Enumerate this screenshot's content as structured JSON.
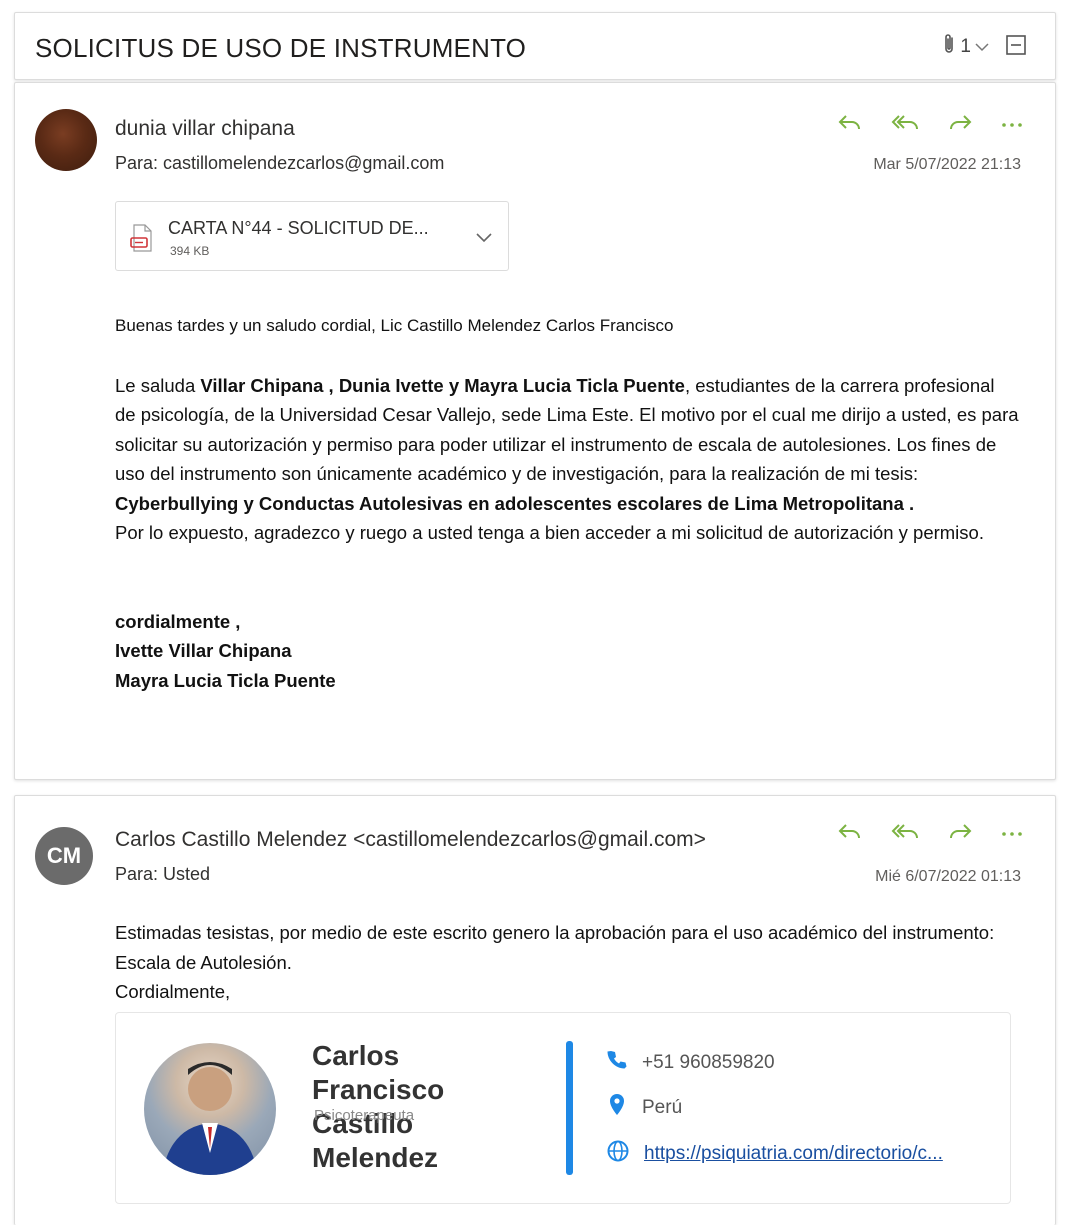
{
  "thread": {
    "subject": "SOLICITUS DE USO DE INSTRUMENTO",
    "attachment_count": "1"
  },
  "message1": {
    "sender": "dunia villar chipana",
    "to": "Para:  castillomelendezcarlos@gmail.com",
    "timestamp": "Mar 5/07/2022 21:13",
    "attachment": {
      "name": "CARTA N°44 - SOLICITUD DE...",
      "size": "394 KB"
    },
    "greeting": "Buenas tardes y un saludo cordial, Lic  Castillo Melendez Carlos Francisco",
    "para1_a": "Le saluda ",
    "para1_b": "Villar Chipana , Dunia Ivette  y Mayra  Lucia Ticla Puente",
    "para1_c": ", estudiantes de la carrera profesional de psicología, de la Universidad Cesar Vallejo, sede Lima Este. El motivo por el cual me dirijo a usted, es para solicitar su autorización y permiso para poder utilizar el instrumento de escala de autolesiones. Los fines de uso del instrumento son únicamente académico y de investigación, para la realización de mi tesis: ",
    "para1_d": "Cyberbullying y Conductas Autolesivas en adolescentes escolares de Lima Metropolitana .",
    "para2": "Por lo expuesto, agradezco y ruego a usted tenga a bien acceder a mi solicitud de autorización y permiso.",
    "sign1": "cordialmente ,",
    "sign2": "Ivette Villar Chipana",
    "sign3": " Mayra  Lucia Ticla Puente"
  },
  "message2": {
    "avatar_initials": "CM",
    "sender": "Carlos Castillo Melendez <castillomelendezcarlos@gmail.com>",
    "to": "Para:  Usted",
    "timestamp": "Mié 6/07/2022 01:13",
    "body1": "Estimadas tesistas, por medio de este escrito genero la aprobación para el uso académico del instrumento: Escala de Autolesión.",
    "body2": "Cordialmente,",
    "signature": {
      "name": "Carlos Francisco Castillo Melendez",
      "role": "Psicoterapeuta",
      "phone": "+51 960859820",
      "location": "Perú",
      "website": "https://psiquiatria.com/directorio/c..."
    }
  },
  "colors": {
    "action_icons": "#7cb342",
    "signature_accent": "#1e88e5",
    "avatar_cm": "#6b6b6b"
  }
}
